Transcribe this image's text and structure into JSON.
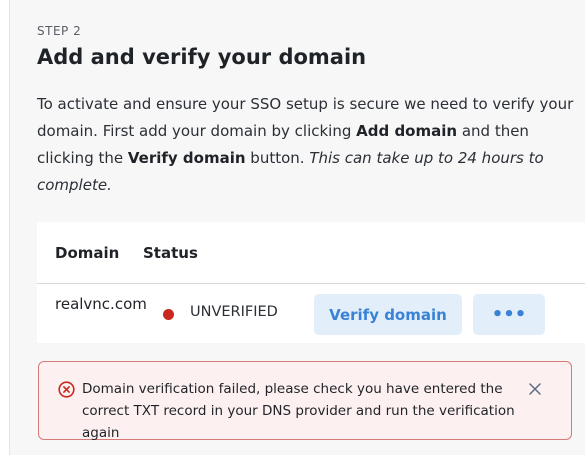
{
  "step": {
    "label": "STEP 2",
    "title": "Add and verify your domain",
    "description": {
      "part1": "To activate and ensure your SSO setup is secure we need to verify your domain. First add your domain by clicking ",
      "bold1": "Add domain",
      "part2": " and then clicking the ",
      "bold2": "Verify domain",
      "part3": " button. ",
      "italic": "This can take up to 24 hours to complete."
    }
  },
  "table": {
    "headers": {
      "domain": "Domain",
      "status": "Status"
    },
    "rows": [
      {
        "domain": "realvnc.com",
        "status": "UNVERIFIED",
        "status_color": "#c8281e",
        "verify_label": "Verify domain",
        "more_label": "•••"
      }
    ]
  },
  "alert": {
    "message": "Domain verification failed, please check you have entered the correct TXT record in your DNS provider and run the verification again",
    "icon": "error-circle-icon",
    "close_icon": "close-icon",
    "color": "#c8281e"
  }
}
